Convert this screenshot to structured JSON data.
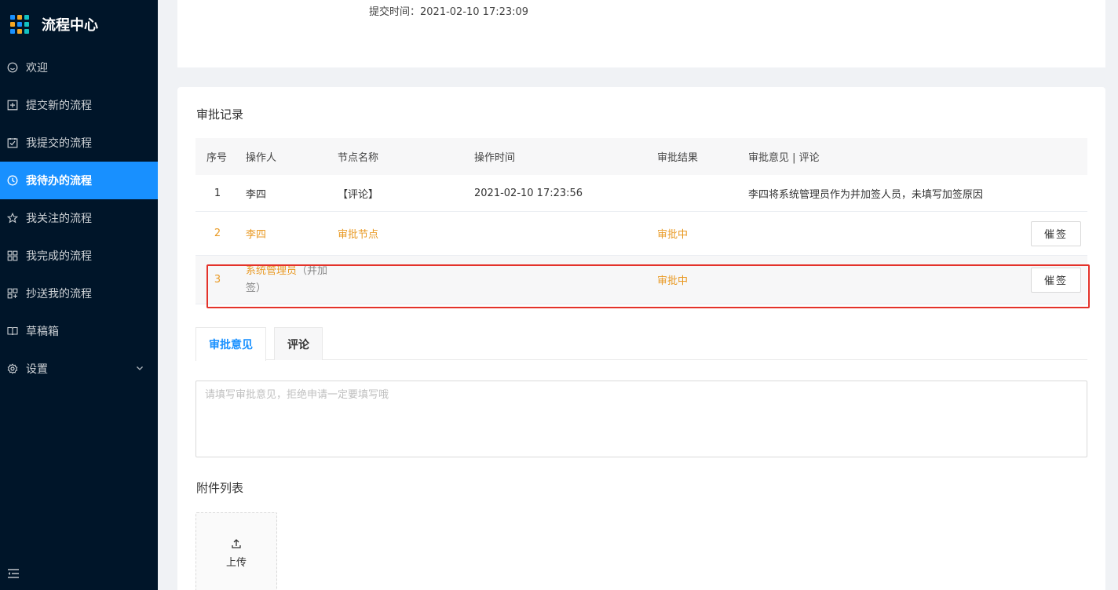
{
  "app": {
    "title": "流程中心"
  },
  "sidebar": {
    "items": [
      {
        "label": "欢迎",
        "icon": "smile-icon"
      },
      {
        "label": "提交新的流程",
        "icon": "plus-square-icon"
      },
      {
        "label": "我提交的流程",
        "icon": "check-square-icon"
      },
      {
        "label": "我待办的流程",
        "icon": "clock-icon",
        "active": true
      },
      {
        "label": "我关注的流程",
        "icon": "star-icon"
      },
      {
        "label": "我完成的流程",
        "icon": "appstore-icon"
      },
      {
        "label": "抄送我的流程",
        "icon": "copy-grid-icon"
      },
      {
        "label": "草稿箱",
        "icon": "book-icon"
      },
      {
        "label": "设置",
        "icon": "setting-icon",
        "has_submenu": true
      }
    ]
  },
  "header_info": {
    "submit_time": "提交时间：2021-02-10 17:23:09"
  },
  "approval": {
    "title": "审批记录",
    "columns": [
      "序号",
      "操作人",
      "节点名称",
      "操作时间",
      "审批结果",
      "审批意见 | 评论"
    ],
    "rows": [
      {
        "no": "1",
        "operator": "李四",
        "operator_note": "",
        "node": "【评论】",
        "time": "2021-02-10 17:23:56",
        "result": "",
        "comment": "李四将系统管理员作为并加签人员，未填写加签原因",
        "action": ""
      },
      {
        "no": "2",
        "operator": "李四",
        "operator_note": "",
        "node": "审批节点",
        "time": "",
        "result": "审批中",
        "comment": "",
        "action": "催签"
      },
      {
        "no": "3",
        "operator": "系统管理员",
        "operator_note": "（并加签）",
        "node": "",
        "time": "",
        "result": "审批中",
        "comment": "",
        "action": "催签"
      }
    ]
  },
  "tabs": [
    {
      "label": "审批意见",
      "active": true
    },
    {
      "label": "评论",
      "active": false
    }
  ],
  "opinion": {
    "placeholder": "请填写审批意见，拒绝申请一定要填写哦",
    "value": ""
  },
  "attachments": {
    "title": "附件列表",
    "upload_label": "上传"
  },
  "colors": {
    "sidebar_bg": "#001529",
    "accent": "#1890ff",
    "pending": "#e99a24",
    "highlight": "#e4322a"
  }
}
